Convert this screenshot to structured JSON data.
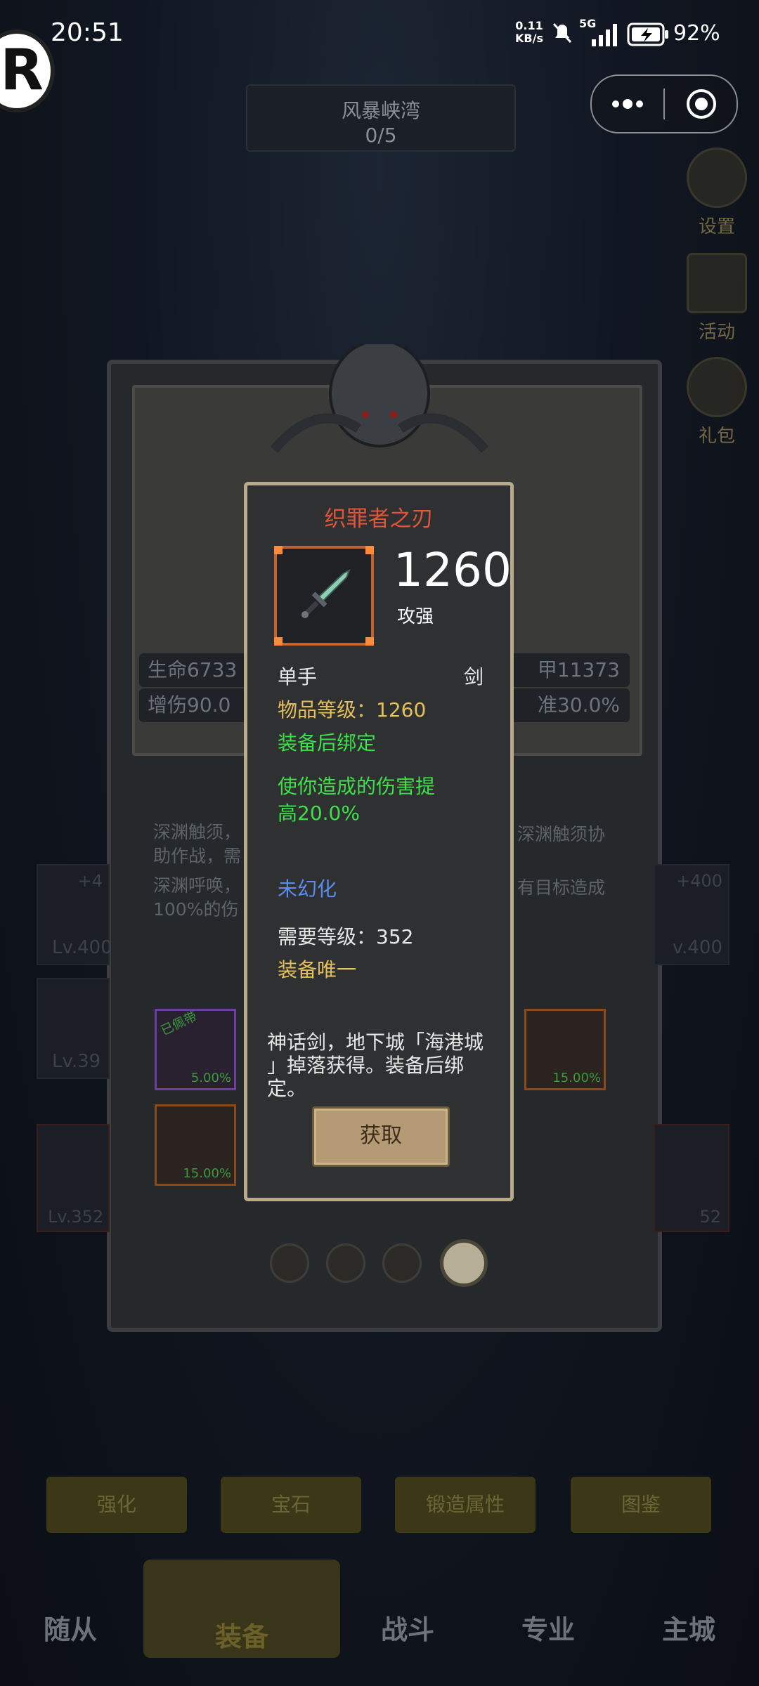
{
  "status_bar": {
    "time": "20:51",
    "net_rate_value": "0.11",
    "net_rate_unit": "KB/s",
    "signal": "5G",
    "battery": "92%"
  },
  "game_hud": {
    "stage_title": "风暴峡湾",
    "stage_progress": "0/5",
    "side_menu": [
      {
        "label": "设置",
        "icon": "gear-icon"
      },
      {
        "label": "活动",
        "icon": "calendar-icon"
      },
      {
        "label": "礼包",
        "icon": "gift-icon"
      }
    ],
    "bg_stats": {
      "left_top": "生命6733",
      "left_bottom": "增伤90.0",
      "right_top": "甲11373",
      "right_bottom": "准30.0%"
    },
    "bg_skill_text_1a": "深渊触须，",
    "bg_skill_text_1b": "助作战，需",
    "bg_skill_text_1c": "深渊触须协",
    "bg_skill_text_2a": "深渊呼唤，",
    "bg_skill_text_2b": "100%的伤",
    "bg_skill_text_2c": "有目标造成",
    "bg_slots": [
      {
        "level": "Lv.400",
        "bonus": "+4"
      },
      {
        "level": "Lv.39"
      },
      {
        "level": "Lv.352"
      }
    ],
    "bg_slots_right": [
      {
        "level": "v.400",
        "bonus": "+400"
      },
      {
        "level": "52"
      }
    ],
    "bg_equipped_badge": "已佩带",
    "bg_item_pcts": [
      "5.00%",
      "15.00%",
      "15.00%"
    ],
    "bottom_tabs": [
      "强化",
      "宝石",
      "锻造属性",
      "图鉴"
    ],
    "nav": [
      "随从",
      "装备",
      "战斗",
      "专业",
      "主城"
    ]
  },
  "dialog": {
    "item_name": "织罪者之刃",
    "item_power": "1260",
    "item_power_label": "攻强",
    "hand_type": "单手",
    "weapon_type": "剑",
    "item_level": "物品等级：1260",
    "bind_note": "装备后绑定",
    "effect_line1": "使你造成的伤害提",
    "effect_line2": "高20.0%",
    "transmog": "未幻化",
    "required_level": "需要等级：352",
    "unique": "装备唯一",
    "description_line1": "神话剑，地下城「海港城",
    "description_line2": "」掉落获得。装备后绑",
    "description_line3": "定。",
    "acquire_button": "获取"
  },
  "pager": {
    "count": 4,
    "active_index": 3
  }
}
